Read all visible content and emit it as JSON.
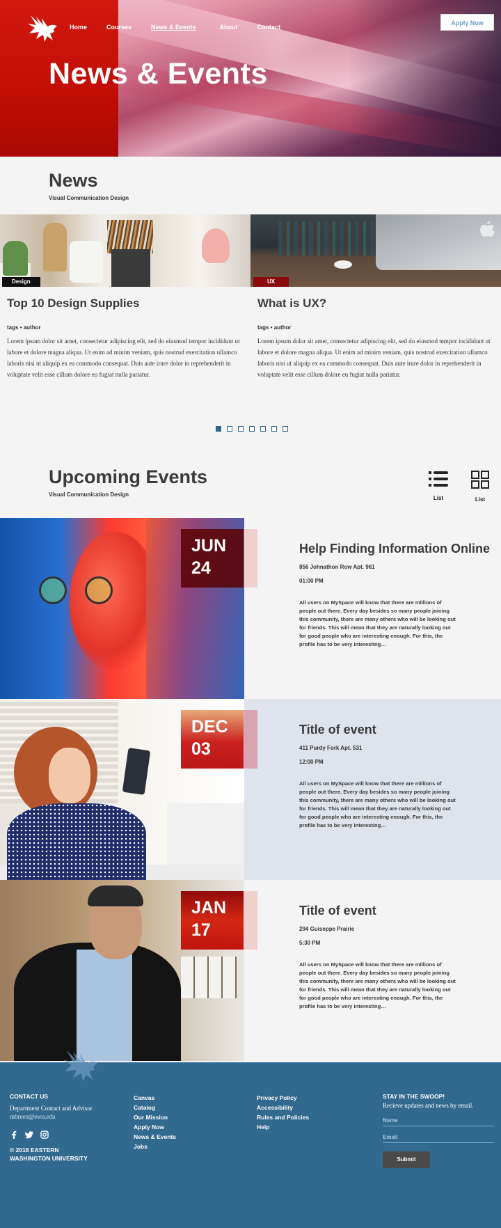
{
  "nav": {
    "items": [
      "Home",
      "Courses",
      "News & Events",
      "About",
      "Contact"
    ],
    "active": "News & Events",
    "apply_label": "Apply Now"
  },
  "hero": {
    "title": "News & Events"
  },
  "news": {
    "title": "News",
    "subtitle": "Visual Communication Design",
    "cards": [
      {
        "tag": "Design",
        "title": "Top 10 Design Supplies",
        "meta": "tags • author",
        "body": "Lorem ipsum dolor sit amet, consectetur adipiscing elit, sed do eiusmod tempor incididunt ut labore et dolore magna aliqua. Ut enim ad minim veniam, quis nostrud exercitation ullamco laboris nisi ut aliquip ex ea commodo consequat. Duis aute irure dolor in reprehenderit in voluptate velit esse cillum dolore eu fugiat nulla pariatur."
      },
      {
        "tag": "UX",
        "title": "What is UX?",
        "meta": "tags • author",
        "body": "Lorem ipsum dolor sit amet, consectetur adipiscing elit, sed do eiusmod tempor incididunt ut labore et dolore magna aliqua. Ut enim ad minim veniam, quis nostrud exercitation ullamco laboris nisi ut aliquip ex ea commodo consequat. Duis aute irure dolor in reprehenderit in voluptate velit esse cillum dolore eu fugiat nulla pariatur."
      }
    ],
    "pagination": {
      "count": 7,
      "active_index": 0
    }
  },
  "events": {
    "title": "Upcoming Events",
    "subtitle": "Visual Communication Design",
    "views": [
      {
        "label": "List",
        "icon": "list-icon"
      },
      {
        "label": "List",
        "icon": "grid-icon"
      }
    ],
    "items": [
      {
        "month": "JUN",
        "day": "24",
        "title": "Help Finding Information Online",
        "address": "856 Johnathon Row Apt. 961",
        "time": "01:00 PM",
        "description": "All users on MySpace will know that there are millions of people out there. Every day besides so many people joining this community, there are many others who will be looking out for friends. This will mean that they are naturally looking out for good people who are interesting enough. For this, the profile has to be very interesting…"
      },
      {
        "month": "DEC",
        "day": "03",
        "title": "Title of event",
        "address": "411 Purdy Fork Apt. 531",
        "time": "12:00 PM",
        "description": "All users on MySpace will know that there are millions of people out there. Every day besides so many people joining this community, there are many others who will be looking out for friends. This will mean that they are naturally looking out for good people who are interesting enough. For this, the profile has to be very interesting…"
      },
      {
        "month": "JAN",
        "day": "17",
        "title": "Title of event",
        "address": "294 Guiseppe Prairie",
        "time": "5:30 PM",
        "description": "All users on MySpace will know that there are millions of people out there. Every day besides so many people joining this community, there are many others who will be looking out for friends. This will mean that they are naturally looking out for good people who are interesting enough. For this, the profile has to be very interesting…"
      }
    ]
  },
  "footer": {
    "contact_head": "CONTACT US",
    "contact_line": "Department Contact and Advisor",
    "contact_email": "mbreen@ewu.edu",
    "socials": [
      "facebook-icon",
      "twitter-icon",
      "instagram-icon"
    ],
    "copyright_1": "© 2018 EASTERN",
    "copyright_2": "WASHINGTON UNIVERSITY",
    "links_1": [
      "Canvas",
      "Catalog",
      "Our Mission",
      "Apply Now",
      "News & Events",
      "Jobs"
    ],
    "links_2": [
      "Privacy Policy",
      "Accessibility",
      "Rules and Policies",
      "Help"
    ],
    "newsletter_head": "STAY IN THE SWOOP!",
    "newsletter_text": "Recieve updates and news by email.",
    "name_placeholder": "Name",
    "email_placeholder": "Email",
    "submit_label": "Submit"
  },
  "colors": {
    "accent_red": "#c10d05",
    "footer_blue": "#32698f",
    "pagination_blue": "#2f648d",
    "apply_text": "#6c9bc4"
  }
}
